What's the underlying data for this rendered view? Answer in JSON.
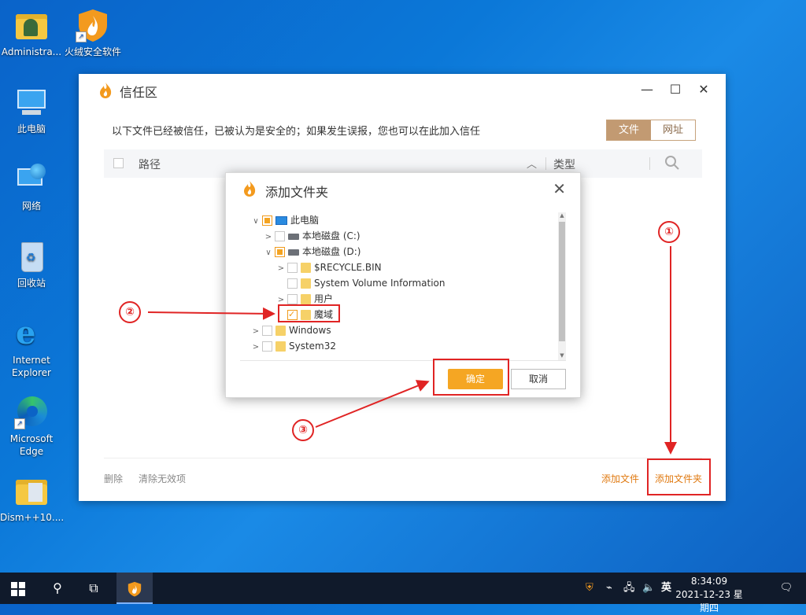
{
  "desktop": {
    "icons": [
      {
        "label": "Administra..."
      },
      {
        "label": "火绒安全软件"
      },
      {
        "label": "此电脑"
      },
      {
        "label": "网络"
      },
      {
        "label": "回收站"
      },
      {
        "label": "Internet Explorer"
      },
      {
        "label": "Microsoft Edge"
      },
      {
        "label": "Dism++10...."
      }
    ]
  },
  "window": {
    "title": "信任区",
    "description": "以下文件已经被信任，已被认为是安全的；如果发生误报，您也可以在此加入信任",
    "tabs": [
      {
        "label": "文件",
        "active": true
      },
      {
        "label": "网址",
        "active": false
      }
    ],
    "table": {
      "col_path": "路径",
      "col_type": "类型"
    },
    "footer": {
      "delete": "删除",
      "clear_invalid": "清除无效项",
      "add_file": "添加文件",
      "add_folder": "添加文件夹"
    }
  },
  "dialog": {
    "title": "添加文件夹",
    "tree": [
      {
        "label": "此电脑"
      },
      {
        "label": "本地磁盘 (C:)"
      },
      {
        "label": "本地磁盘 (D:)"
      },
      {
        "label": "$RECYCLE.BIN"
      },
      {
        "label": "System Volume Information"
      },
      {
        "label": "用户"
      },
      {
        "label": "魔域"
      },
      {
        "label": "Windows"
      },
      {
        "label": "System32"
      }
    ],
    "ok": "确定",
    "cancel": "取消"
  },
  "annotations": {
    "n1": "①",
    "n2": "②",
    "n3": "③"
  },
  "taskbar": {
    "ime": "英",
    "time": "8:34:09",
    "date": "2021-12-23 星期四"
  },
  "colors": {
    "accent": "#f5a623",
    "annotation": "#e02424",
    "tab_active": "#c29a72"
  }
}
